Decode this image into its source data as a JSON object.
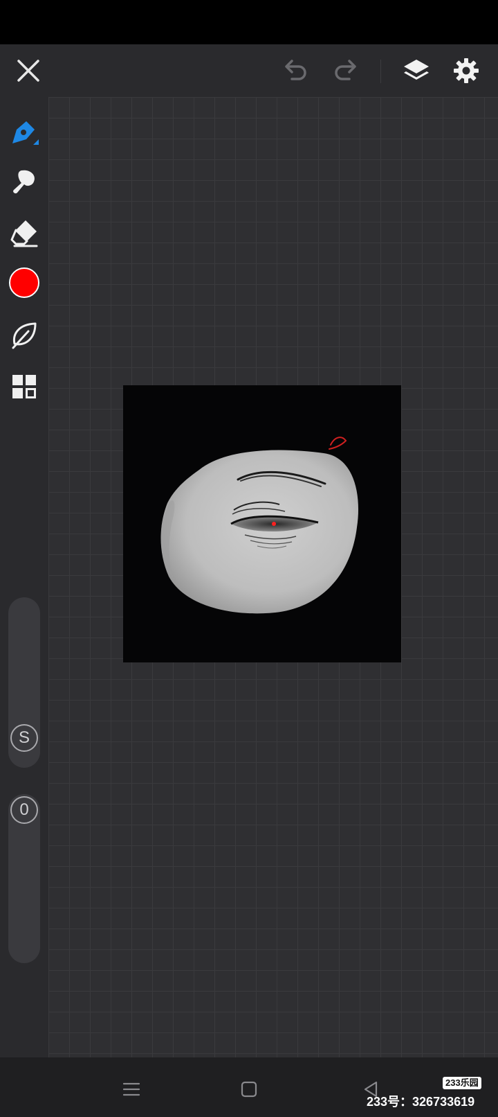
{
  "icons": {
    "close": "close-icon",
    "undo": "undo-icon",
    "redo": "redo-icon",
    "layers": "layers-icon",
    "settings": "gear-icon",
    "brush": "pen-brush-icon",
    "smudge": "smudge-icon",
    "eraser": "eraser-icon",
    "color": "color-swatch",
    "stabilizer": "leaf-icon",
    "gallery": "grid-icon"
  },
  "colors": {
    "accent": "#1e88e5",
    "current_color": "#ff0000",
    "toolbar_bg": "#2a2a2d",
    "canvas_bg": "#2f2f32"
  },
  "sliders": {
    "size_label": "S",
    "opacity_label": "0"
  },
  "watermark": {
    "logo": "233乐园",
    "text": "233号：326733619"
  }
}
